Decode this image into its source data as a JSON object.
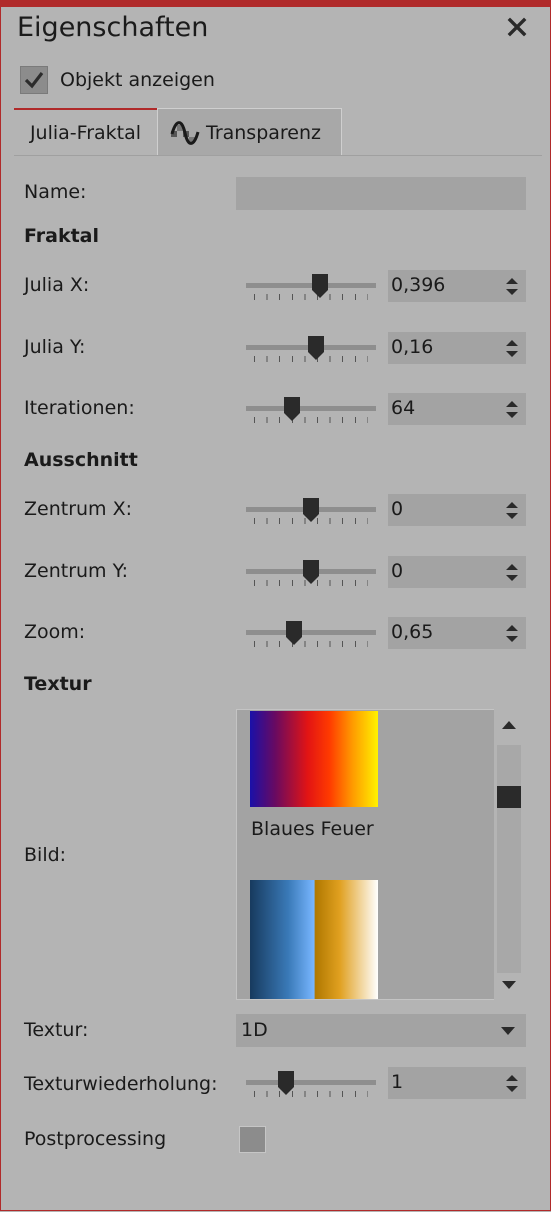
{
  "panel": {
    "title": "Eigenschaften",
    "close_symbol": "×"
  },
  "show_object": {
    "label": "Objekt anzeigen",
    "checked": true
  },
  "tabs": [
    {
      "label": "Julia-Fraktal",
      "active": true
    },
    {
      "label": "Transparenz",
      "icon": "transparency-wave-icon",
      "active": false
    }
  ],
  "name_field": {
    "label": "Name:",
    "value": ""
  },
  "sections": {
    "fractal": "Fraktal",
    "crop": "Ausschnitt",
    "texture": "Textur"
  },
  "params": {
    "julia_x": {
      "label": "Julia X:",
      "value": "0,396",
      "slider_fraction": 0.58
    },
    "julia_y": {
      "label": "Julia Y:",
      "value": "0,16",
      "slider_fraction": 0.54
    },
    "iterations": {
      "label": "Iterationen:",
      "value": "64",
      "slider_fraction": 0.33
    },
    "center_x": {
      "label": "Zentrum X:",
      "value": "0",
      "slider_fraction": 0.5
    },
    "center_y": {
      "label": "Zentrum Y:",
      "value": "0",
      "slider_fraction": 0.5
    },
    "zoom": {
      "label": "Zoom:",
      "value": "0,65",
      "slider_fraction": 0.35
    },
    "texture_repeat": {
      "label": "Texturwiederholung:",
      "value": "1",
      "slider_fraction": 0.28
    }
  },
  "image_picker": {
    "label": "Bild:",
    "items": [
      {
        "name": "Blaues Feuer"
      }
    ],
    "scroll_fraction": 0.2
  },
  "texture_select": {
    "label": "Textur:",
    "value": "1D"
  },
  "postprocessing": {
    "label": "Postprocessing",
    "checked": false
  }
}
